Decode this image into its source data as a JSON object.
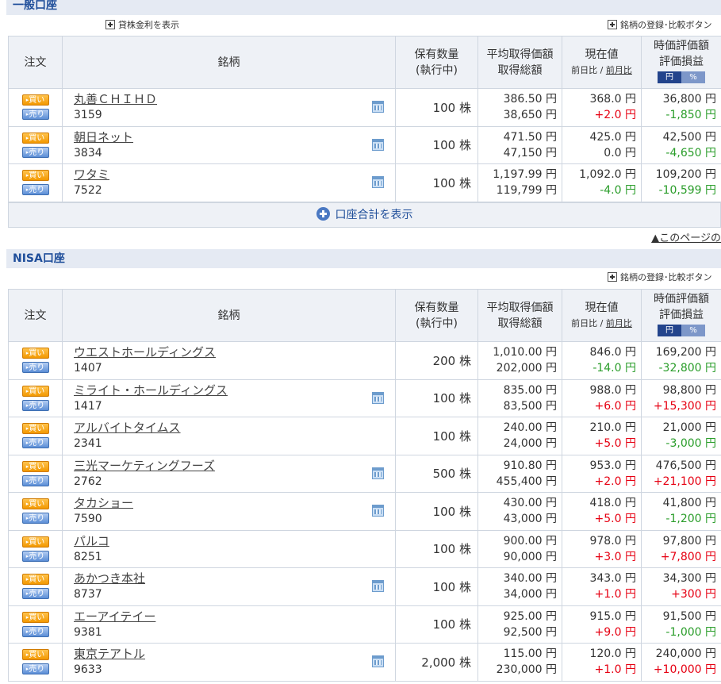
{
  "general": {
    "title": "一般口座",
    "lending_link": "貸株金利を表示",
    "compare_link": "銘柄の登録･比較ボタン",
    "rows": [
      {
        "name": "丸善ＣＨＩＨＤ",
        "code": "3159",
        "cal": true,
        "qty": "100 株",
        "avg": "386.50 円",
        "total": "38,650 円",
        "price": "368.0 円",
        "change": "+2.0 円",
        "change_sign": "pos",
        "value": "36,800 円",
        "pl": "-1,850 円",
        "pl_sign": "neg"
      },
      {
        "name": "朝日ネット",
        "code": "3834",
        "cal": true,
        "qty": "100 株",
        "avg": "471.50 円",
        "total": "47,150 円",
        "price": "425.0 円",
        "change": "0.0 円",
        "change_sign": "zero",
        "value": "42,500 円",
        "pl": "-4,650 円",
        "pl_sign": "neg"
      },
      {
        "name": "ワタミ",
        "code": "7522",
        "cal": true,
        "qty": "100 株",
        "avg": "1,197.99 円",
        "total": "119,799 円",
        "price": "1,092.0 円",
        "change": "-4.0 円",
        "change_sign": "neg",
        "value": "109,200 円",
        "pl": "-10,599 円",
        "pl_sign": "neg"
      }
    ],
    "show_total": "口座合計を表示"
  },
  "page_top": "▲このページの",
  "nisa": {
    "title": "NISA口座",
    "compare_link": "銘柄の登録･比較ボタン",
    "rows": [
      {
        "name": "ウエストホールディングス",
        "code": "1407",
        "cal": false,
        "qty": "200 株",
        "avg": "1,010.00 円",
        "total": "202,000 円",
        "price": "846.0 円",
        "change": "-14.0 円",
        "change_sign": "neg",
        "value": "169,200 円",
        "pl": "-32,800 円",
        "pl_sign": "neg"
      },
      {
        "name": "ミライト・ホールディングス",
        "code": "1417",
        "cal": true,
        "qty": "100 株",
        "avg": "835.00 円",
        "total": "83,500 円",
        "price": "988.0 円",
        "change": "+6.0 円",
        "change_sign": "pos",
        "value": "98,800 円",
        "pl": "+15,300 円",
        "pl_sign": "pos"
      },
      {
        "name": "アルバイトタイムス",
        "code": "2341",
        "cal": false,
        "qty": "100 株",
        "avg": "240.00 円",
        "total": "24,000 円",
        "price": "210.0 円",
        "change": "+5.0 円",
        "change_sign": "pos",
        "value": "21,000 円",
        "pl": "-3,000 円",
        "pl_sign": "neg"
      },
      {
        "name": "三光マーケティングフーズ",
        "code": "2762",
        "cal": true,
        "qty": "500 株",
        "avg": "910.80 円",
        "total": "455,400 円",
        "price": "953.0 円",
        "change": "+2.0 円",
        "change_sign": "pos",
        "value": "476,500 円",
        "pl": "+21,100 円",
        "pl_sign": "pos"
      },
      {
        "name": "タカショー",
        "code": "7590",
        "cal": true,
        "qty": "100 株",
        "avg": "430.00 円",
        "total": "43,000 円",
        "price": "418.0 円",
        "change": "+5.0 円",
        "change_sign": "pos",
        "value": "41,800 円",
        "pl": "-1,200 円",
        "pl_sign": "neg"
      },
      {
        "name": "パルコ",
        "code": "8251",
        "cal": false,
        "qty": "100 株",
        "avg": "900.00 円",
        "total": "90,000 円",
        "price": "978.0 円",
        "change": "+3.0 円",
        "change_sign": "pos",
        "value": "97,800 円",
        "pl": "+7,800 円",
        "pl_sign": "pos"
      },
      {
        "name": "あかつき本社",
        "code": "8737",
        "cal": true,
        "qty": "100 株",
        "avg": "340.00 円",
        "total": "34,000 円",
        "price": "343.0 円",
        "change": "+1.0 円",
        "change_sign": "pos",
        "value": "34,300 円",
        "pl": "+300 円",
        "pl_sign": "pos"
      },
      {
        "name": "エーアイテイー",
        "code": "9381",
        "cal": false,
        "qty": "100 株",
        "avg": "925.00 円",
        "total": "92,500 円",
        "price": "915.0 円",
        "change": "+9.0 円",
        "change_sign": "pos",
        "value": "91,500 円",
        "pl": "-1,000 円",
        "pl_sign": "neg"
      },
      {
        "name": "東京テアトル",
        "code": "9633",
        "cal": true,
        "qty": "2,000 株",
        "avg": "115.00 円",
        "total": "230,000 円",
        "price": "120.0 円",
        "change": "+1.0 円",
        "change_sign": "pos",
        "value": "240,000 円",
        "pl": "+10,000 円",
        "pl_sign": "pos"
      }
    ]
  },
  "headers": {
    "order": "注文",
    "stock": "銘柄",
    "qty_line1": "保有数量",
    "qty_line2": "(執行中)",
    "avg_line1": "平均取得価額",
    "avg_line2": "取得総額",
    "price_line1": "現在値",
    "price_sub1": "前日比",
    "price_sep": " / ",
    "price_sub2": "前月比",
    "value_line1": "時価評価額",
    "value_line2": "評価損益",
    "toggle_yen": "円",
    "toggle_pct": "%",
    "buy": "買い",
    "sell": "売り"
  }
}
